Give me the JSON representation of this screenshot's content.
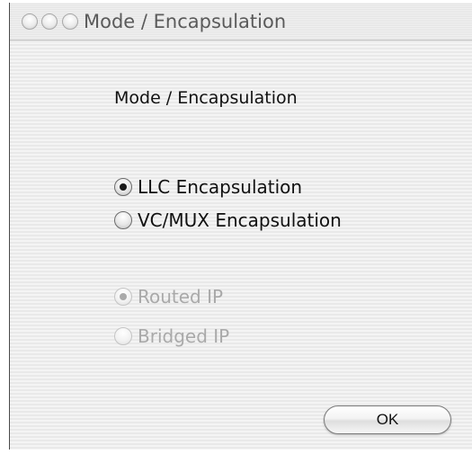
{
  "window": {
    "title": "Mode / Encapsulation"
  },
  "dialog": {
    "heading": "Mode / Encapsulation",
    "encapsulation_options": [
      {
        "label": "LLC Encapsulation",
        "selected": true,
        "enabled": true
      },
      {
        "label": "VC/MUX Encapsulation",
        "selected": false,
        "enabled": true
      }
    ],
    "mode_options": [
      {
        "label": "Routed IP",
        "selected": true,
        "enabled": false
      },
      {
        "label": "Bridged IP",
        "selected": false,
        "enabled": false
      }
    ],
    "ok_label": "OK"
  },
  "icons": {
    "close": "close-icon",
    "minimize": "minimize-icon",
    "zoom": "zoom-icon",
    "radio_selected": "radio-selected-icon",
    "radio_unselected": "radio-unselected-icon"
  },
  "colors": {
    "text": "#111111",
    "disabled_text": "#a9a9a9",
    "title_text": "#5a5a5a"
  }
}
